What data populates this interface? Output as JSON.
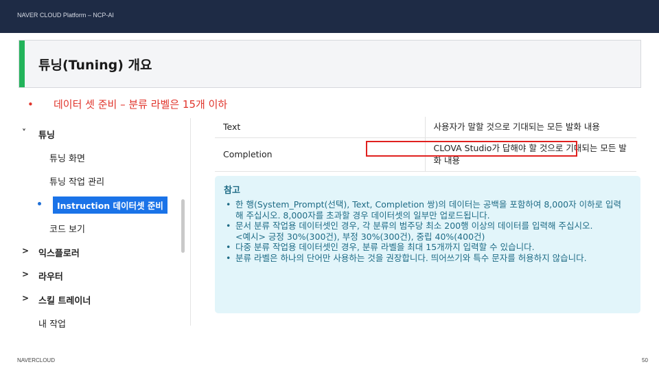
{
  "header": {
    "brand": "NAVER CLOUD Platform – NCP-AI"
  },
  "slide": {
    "title": "튜닝(Tuning) 개요",
    "subtitle": "데이터 셋 준비 – 분류  라벨은 15개 이하"
  },
  "sidebar": {
    "items": [
      {
        "label": "튜닝",
        "chevron": "˅"
      },
      {
        "label": "튜닝 화면"
      },
      {
        "label": "튜닝 작업 관리"
      },
      {
        "label": "Instruction 데이터셋 준비"
      },
      {
        "label": "코드 보기"
      },
      {
        "label": "익스플로러",
        "chevron": ">"
      },
      {
        "label": "라우터",
        "chevron": ">"
      },
      {
        "label": "스킬 트레이너",
        "chevron": ">"
      },
      {
        "label": "내 작업"
      }
    ]
  },
  "table": {
    "rows": [
      {
        "key": "Text",
        "value": "사용자가 말할 것으로 기대되는 모든 발화 내용"
      },
      {
        "key": "Completion",
        "value": "CLOVA Studio가 답해야 할 것으로 기대되는 모든 발화 내용"
      }
    ]
  },
  "note": {
    "title": "참고",
    "lines": [
      "한 행(System_Prompt(선택), Text, Completion 쌍)의 데이터는 공백을 포함하여 8,000자 이하로 입력해 주십시오. 8,000자를 초과할 경우 데이터셋의 일부만 업로드됩니다.",
      "문서 분류 작업용 데이터셋인 경우, 각 분류의 범주당 최소 200행 이상의 데이터를 입력해 주십시오.",
      "<예시> 긍정 30%(300건), 부정 30%(300건), 중립 40%(400건)",
      "다중 분류 작업용 데이터셋인 경우, 분류 라벨을 최대 15개까지 입력할 수 있습니다.",
      "분류 라벨은 하나의 단어만 사용하는 것을 권장합니다. 띄어쓰기와 특수 문자를 허용하지 않습니다."
    ]
  },
  "footer": {
    "left": "NAVERCLOUD",
    "page": "50"
  },
  "colors": {
    "header_bg": "#1e2b45",
    "accent_green": "#22b35a",
    "subtitle_red": "#e0342b",
    "nav_active": "#1a73e8",
    "note_bg": "#e2f5fa",
    "note_text": "#1e6b85",
    "highlight_red": "#e0201e"
  }
}
